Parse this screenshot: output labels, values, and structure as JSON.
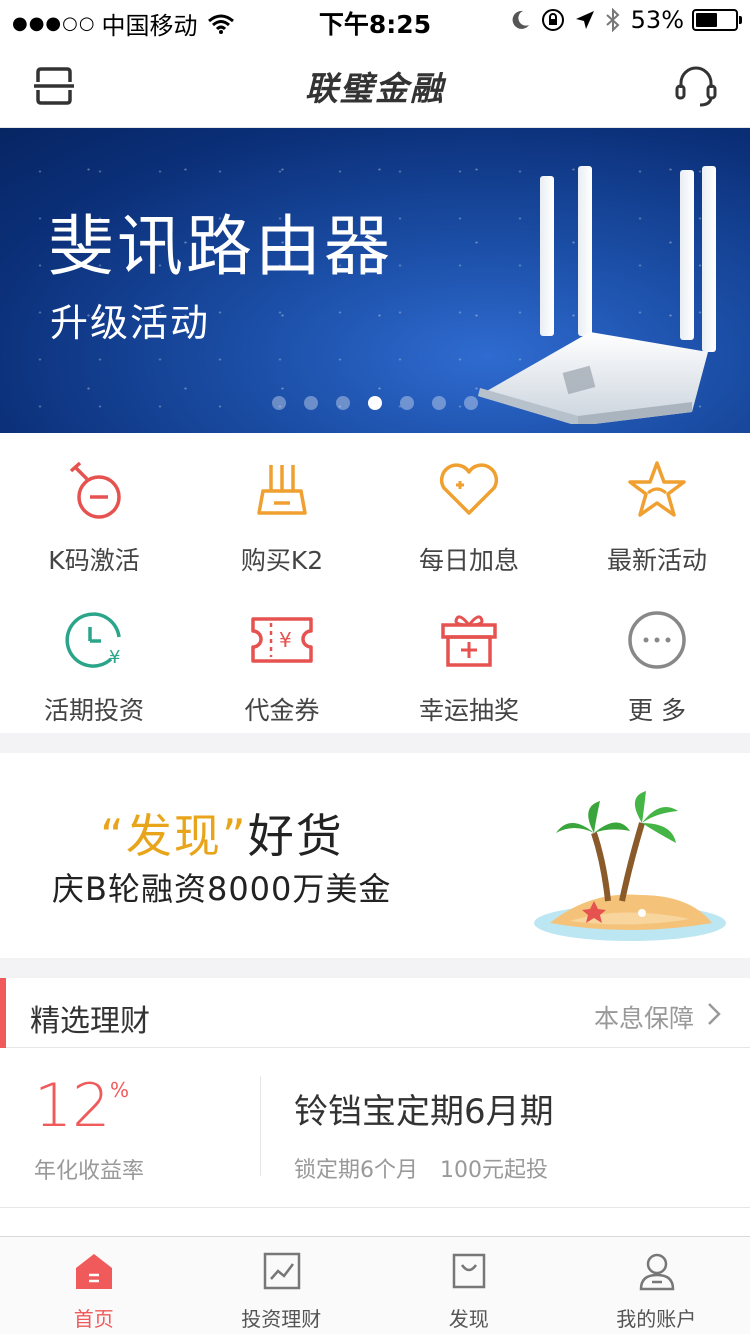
{
  "status_bar": {
    "carrier": "中国移动",
    "time": "下午8:25",
    "battery": "53%"
  },
  "header": {
    "title": "联璧金融"
  },
  "banner": {
    "title": "斐讯路由器",
    "subtitle": "升级活动",
    "page_count": 7,
    "active_page": 4
  },
  "grid": {
    "items": [
      {
        "label": "K码激活",
        "icon": "stopwatch-minus-icon",
        "color": "#e5524f"
      },
      {
        "label": "购买K2",
        "icon": "router-icon",
        "color": "#f0a030"
      },
      {
        "label": "每日加息",
        "icon": "heart-plus-icon",
        "color": "#f0a030"
      },
      {
        "label": "最新活动",
        "icon": "star-icon",
        "color": "#f0a030"
      },
      {
        "label": "活期投资",
        "icon": "clock-yen-icon",
        "color": "#2aa58a"
      },
      {
        "label": "代金券",
        "icon": "coupon-icon",
        "color": "#e5524f"
      },
      {
        "label": "幸运抽奖",
        "icon": "gift-icon",
        "color": "#e5524f"
      },
      {
        "label": "更 多",
        "icon": "more-icon",
        "color": "#888888"
      }
    ]
  },
  "promo": {
    "open_quote": "“",
    "highlight": "发现",
    "close_quote": "”",
    "rest": "好货",
    "line2": "庆B轮融资8000万美金"
  },
  "section": {
    "title": "精选理财",
    "right_label": "本息保障"
  },
  "product": {
    "rate": "12",
    "rate_unit": "%",
    "rate_label": "年化收益率",
    "name": "铃铛宝定期6月期",
    "term": "锁定期6个月",
    "min_invest": "100元起投"
  },
  "tab_bar": {
    "tabs": [
      {
        "label": "首页",
        "icon": "home-icon",
        "active": true
      },
      {
        "label": "投资理财",
        "icon": "chart-icon",
        "active": false
      },
      {
        "label": "发现",
        "icon": "bag-icon",
        "active": false
      },
      {
        "label": "我的账户",
        "icon": "user-icon",
        "active": false
      }
    ]
  },
  "colors": {
    "accent": "#f05a5a",
    "gold": "#e8a51c",
    "banner_blue": "#1b4ea6"
  }
}
